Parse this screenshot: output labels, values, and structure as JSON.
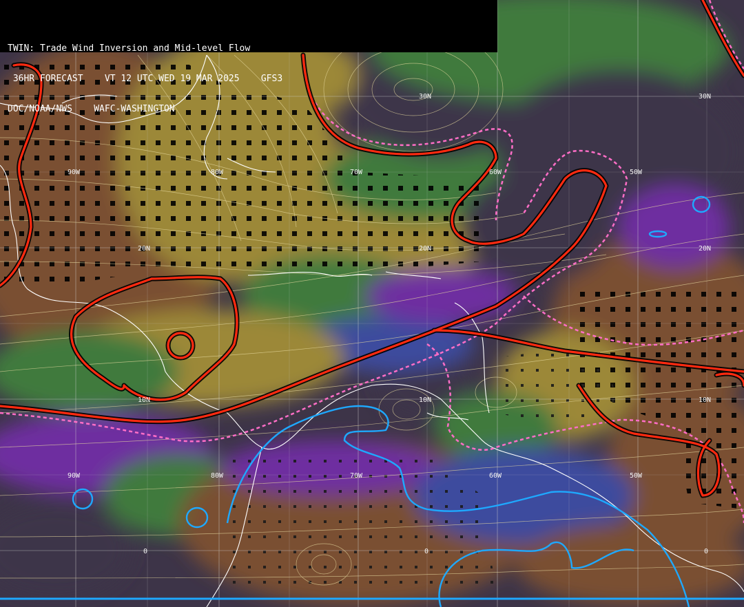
{
  "header": {
    "line1": "TWIN: Trade Wind Inversion and Mid-level Flow",
    "line2": " 36HR FORECAST    VT 12 UTC WED 19 MAR 2025    GFS3",
    "line3": "DOC/NOAA/NWS    WAFC-WASHINGTON"
  },
  "grid_labels": {
    "lat_30n_a": "30N",
    "lat_30n_b": "30N",
    "lat_20n_a": "20N",
    "lat_20n_b": "20N",
    "lat_20n_c": "20N",
    "lat_10n_a": "10N",
    "lat_10n_b": "10N",
    "lat_10n_c": "10N",
    "lon_90w_a": "90W",
    "lon_80w_a": "80W",
    "lon_70w_a": "70W",
    "lon_60w_a": "60W",
    "lon_50w_a": "50W",
    "lon_90w_b": "90W",
    "lon_80w_b": "80W",
    "lon_70w_b": "70W",
    "lon_60w_b": "60W",
    "lon_50w_b": "50W",
    "eq_a": "0",
    "eq_b": "0",
    "eq_c": "0"
  },
  "colors": {
    "background_dark": "#3d3448",
    "brown": "#7a5030",
    "olive": "#9c8838",
    "green": "#3f7a3c",
    "blue": "#3e4c9e",
    "purple": "#6e2ea0",
    "inversion_contour": "#ff2a10",
    "dashed_contour": "#ff6ec7",
    "cyan_contour": "#1ea9ff",
    "streamline": "#e8dba0",
    "coastline": "#ffffff"
  }
}
